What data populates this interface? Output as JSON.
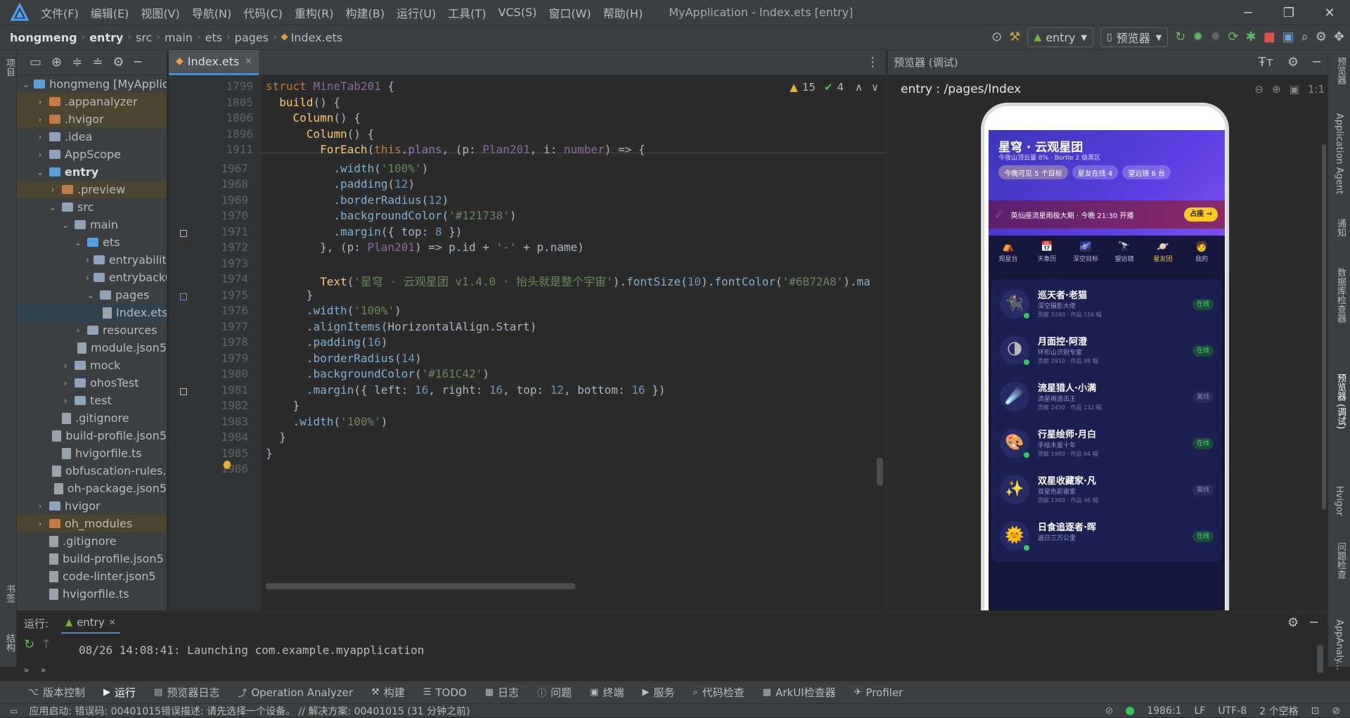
{
  "window": {
    "title": "MyApplication - Index.ets [entry]",
    "menu": [
      "文件(F)",
      "编辑(E)",
      "视图(V)",
      "导航(N)",
      "代码(C)",
      "重构(R)",
      "构建(B)",
      "运行(U)",
      "工具(T)",
      "VCS(S)",
      "窗口(W)",
      "帮助(H)"
    ]
  },
  "breadcrumb": [
    "hongmeng",
    "entry",
    "src",
    "main",
    "ets",
    "pages",
    "Index.ets"
  ],
  "toolbar": {
    "module": "entry",
    "device": "预览器"
  },
  "project_tree": [
    {
      "label": "hongmeng [MyApplication]",
      "level": 0,
      "type": "folder-blue",
      "open": true
    },
    {
      "label": ".appanalyzer",
      "level": 1,
      "type": "folder-orange",
      "open": false,
      "hl": true
    },
    {
      "label": ".hvigor",
      "level": 1,
      "type": "folder-orange",
      "open": false,
      "hl": true
    },
    {
      "label": ".idea",
      "level": 1,
      "type": "folder",
      "open": false
    },
    {
      "label": "AppScope",
      "level": 1,
      "type": "folder",
      "open": false
    },
    {
      "label": "entry",
      "level": 1,
      "type": "folder-blue",
      "open": true,
      "bold": true
    },
    {
      "label": ".preview",
      "level": 2,
      "type": "folder-orange",
      "open": false,
      "hl": true
    },
    {
      "label": "src",
      "level": 2,
      "type": "folder",
      "open": true
    },
    {
      "label": "main",
      "level": 3,
      "type": "folder",
      "open": true
    },
    {
      "label": "ets",
      "level": 4,
      "type": "folder-blue",
      "open": true
    },
    {
      "label": "entryability",
      "level": 5,
      "type": "folder",
      "open": false
    },
    {
      "label": "entrybackupability",
      "level": 5,
      "type": "folder",
      "open": false
    },
    {
      "label": "pages",
      "level": 5,
      "type": "folder",
      "open": true
    },
    {
      "label": "Index.ets",
      "level": 6,
      "type": "file"
    },
    {
      "label": "resources",
      "level": 4,
      "type": "folder",
      "open": false
    },
    {
      "label": "module.json5",
      "level": 4,
      "type": "file"
    },
    {
      "label": "mock",
      "level": 3,
      "type": "folder",
      "open": false
    },
    {
      "label": "ohosTest",
      "level": 3,
      "type": "folder",
      "open": false
    },
    {
      "label": "test",
      "level": 3,
      "type": "folder",
      "open": false
    },
    {
      "label": ".gitignore",
      "level": 2,
      "type": "file"
    },
    {
      "label": "build-profile.json5",
      "level": 2,
      "type": "file"
    },
    {
      "label": "hvigorfile.ts",
      "level": 2,
      "type": "file"
    },
    {
      "label": "obfuscation-rules.txt",
      "level": 2,
      "type": "file"
    },
    {
      "label": "oh-package.json5",
      "level": 2,
      "type": "file"
    },
    {
      "label": "hvigor",
      "level": 1,
      "type": "folder",
      "open": false
    },
    {
      "label": "oh_modules",
      "level": 1,
      "type": "folder-orange",
      "open": false,
      "hl": true
    },
    {
      "label": ".gitignore",
      "level": 1,
      "type": "file"
    },
    {
      "label": "build-profile.json5",
      "level": 1,
      "type": "file"
    },
    {
      "label": "code-linter.json5",
      "level": 1,
      "type": "file"
    },
    {
      "label": "hvigorfile.ts",
      "level": 1,
      "type": "file"
    }
  ],
  "editor": {
    "tab": "Index.ets",
    "inspection": {
      "warnings": "15",
      "ok": "4"
    }
  },
  "code_lines": [
    {
      "n": "1799",
      "html": "<span class='kw'>struct</span> <span class='ty'>MineTab201</span> {"
    },
    {
      "n": "1805",
      "html": "  <span class='fn'>build</span>() {"
    },
    {
      "n": "1806",
      "html": "    <span class='fn'>Column</span>() {"
    },
    {
      "n": "1896",
      "html": "      <span class='fn'>Column</span>() {"
    },
    {
      "n": "1911",
      "html": "        <span class='fn'>ForEach</span>(<span class='kw'>this</span>.<span class='pr'>plans</span>, (p: <span class='ty'>Plan201</span>, i: <span class='ty'>number</span>) => {"
    },
    {
      "n": "1967",
      "html": "          .<span class='me'>width</span>(<span class='st'>'100%'</span>)"
    },
    {
      "n": "1968",
      "html": "          .<span class='me'>padding</span>(<span class='nm'>12</span>)"
    },
    {
      "n": "1969",
      "html": "          .<span class='me'>borderRadius</span>(<span class='nm'>12</span>)"
    },
    {
      "n": "1970",
      "html": "          .<span class='me'>backgroundColor</span>(<span class='st'>'#121738'</span>)"
    },
    {
      "n": "1971",
      "html": "          .<span class='me'>margin</span>({ top: <span class='nm'>8</span> })"
    },
    {
      "n": "1972",
      "html": "        }, (p: <span class='ty'>Plan201</span>) => p.id + <span class='st'>'-'</span> + p.name)"
    },
    {
      "n": "1973",
      "html": ""
    },
    {
      "n": "1974",
      "html": "        <span class='fn'>Text</span>(<span class='st'>'星穹 · 云观星团 v1.4.0 · 抬头就是整个宇宙'</span>).<span class='me'>fontSize</span>(<span class='nm'>10</span>).<span class='me'>fontColor</span>(<span class='st'>'#6B72A8'</span>).<span class='me'>ma</span>"
    },
    {
      "n": "1975",
      "html": "      }"
    },
    {
      "n": "1976",
      "html": "      .<span class='me'>width</span>(<span class='st'>'100%'</span>)"
    },
    {
      "n": "1977",
      "html": "      .<span class='me'>alignItems</span>(HorizontalAlign.Start)"
    },
    {
      "n": "1978",
      "html": "      .<span class='me'>padding</span>(<span class='nm'>16</span>)"
    },
    {
      "n": "1979",
      "html": "      .<span class='me'>borderRadius</span>(<span class='nm'>14</span>)"
    },
    {
      "n": "1980",
      "html": "      .<span class='me'>backgroundColor</span>(<span class='st'>'#161C42'</span>)"
    },
    {
      "n": "1981",
      "html": "      .<span class='me'>margin</span>({ left: <span class='nm'>16</span>, right: <span class='nm'>16</span>, top: <span class='nm'>12</span>, bottom: <span class='nm'>16</span> })"
    },
    {
      "n": "1982",
      "html": "    }"
    },
    {
      "n": "1983",
      "html": "    .<span class='me'>width</span>(<span class='st'>'100%'</span>)"
    },
    {
      "n": "1984",
      "html": "  }"
    },
    {
      "n": "1985",
      "html": "}"
    },
    {
      "n": "1986",
      "html": ""
    }
  ],
  "preview": {
    "panel_title": "预览器 (调试)",
    "route": "entry : /pages/Index",
    "app": {
      "title": "星穹 · 云观星团",
      "subtitle": "今夜山顶云量 8% · Bortle 2 级黑区",
      "chips": [
        "今晚可见 5 个目标",
        "星友在线 4",
        "望远镜 6 台"
      ],
      "banner": "英仙座流星雨极大期 · 今晚 21:30 开播",
      "banner_btn": "占座 →",
      "nav": [
        "观星台",
        "天象历",
        "深空目标",
        "望远镜",
        "星友团",
        "我的"
      ],
      "nav_icons": [
        "⛺",
        "📅",
        "🌌",
        "🔭",
        "🪐",
        "🧑"
      ],
      "nav_active": 4,
      "friends": [
        {
          "name": "巡天者·老猫",
          "desc": "深空摄影大佬",
          "meta": "贡献 3280 · 作品 156 幅",
          "status": "在线",
          "online": true,
          "icon": "🐈‍⬛"
        },
        {
          "name": "月面控·阿澄",
          "desc": "环形山识别专家",
          "meta": "贡献 2910 · 作品 98 幅",
          "status": "在线",
          "online": true,
          "icon": "🌗"
        },
        {
          "name": "流星猎人·小满",
          "desc": "流星雨追击王",
          "meta": "贡献 2450 · 作品 132 幅",
          "status": "离线",
          "online": false,
          "icon": "☄️"
        },
        {
          "name": "行星绘师·月白",
          "desc": "手绘木星十年",
          "meta": "贡献 1980 · 作品 64 幅",
          "status": "在线",
          "online": true,
          "icon": "🎨"
        },
        {
          "name": "双星收藏家·凡",
          "desc": "双星色彩雷家",
          "meta": "贡献 1360 · 作品 46 幅",
          "status": "离线",
          "online": false,
          "icon": "✨"
        },
        {
          "name": "日食追逐者·晖",
          "desc": "追日三万公里",
          "meta": "",
          "status": "在线",
          "online": true,
          "icon": "🌞"
        }
      ]
    }
  },
  "run": {
    "label": "运行:",
    "tab": "entry",
    "log": "08/26 14:08:41: Launching com.example.myapplication"
  },
  "bottom_tabs": [
    "版本控制",
    "运行",
    "预览器日志",
    "Operation Analyzer",
    "构建",
    "TODO",
    "日志",
    "问题",
    "终端",
    "服务",
    "代码检查",
    "ArkUI检查器",
    "Profiler"
  ],
  "status": {
    "message": "应用启动: 错误码: 00401015错误描述: 请先选择一个设备。 // 解决方案: 00401015 (31 分钟之前)",
    "position": "1986:1",
    "line_sep": "LF",
    "encoding": "UTF-8",
    "indent": "2 个空格"
  },
  "left_strip": [
    "项目",
    "书签",
    "结构"
  ],
  "right_strip": [
    "预览器",
    "Application Agent",
    "通知",
    "数据库检查器",
    "预览器 (调试)",
    "Hvigor",
    "问题检查",
    "AppAnaly..."
  ]
}
